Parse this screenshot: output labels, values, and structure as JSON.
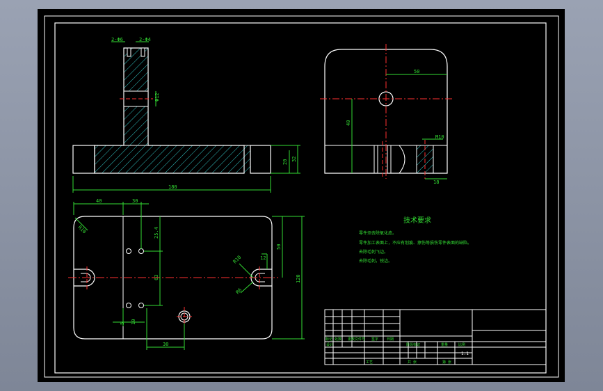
{
  "front_view": {
    "dim_top_left": "2-Φ6",
    "dim_top_right": "2-Φ4",
    "dim_slot": "Φ12",
    "dim_height_inner": "20",
    "dim_height_outer": "32",
    "dim_width": "180"
  },
  "side_view": {
    "dim_horizontal": "50",
    "dim_vertical": "40",
    "dim_small": "M10",
    "dim_bottom": "18"
  },
  "plan_view": {
    "dim_top_a": "40",
    "dim_top_b": "30",
    "dim_vert_a": "25.4",
    "dim_vert_b": "50",
    "dim_center": "63",
    "dim_right_inner": "50",
    "dim_right_outer": "120",
    "dim_right_small": "12",
    "dim_corner_radius": "R10",
    "dim_slot_r": "R10",
    "dim_slot_w": "R6",
    "dim_bottom_a": "5",
    "dim_bottom_b": "10",
    "dim_bottom_c": "30"
  },
  "technical_requirements": {
    "title": "技术要求",
    "lines": [
      "零件须去除氧化皮。",
      "零件加工表面上，不应有划痕、擦伤等损伤零件表面的缺陷。",
      "去除毛刺飞边。",
      "去除毛刺，锐边。"
    ]
  },
  "title_block": {
    "row_labels": [
      "标记",
      "处数",
      "更改文件号",
      "签字",
      "日期"
    ],
    "design": "设计",
    "process": "工艺",
    "stage_label": "阶段标记",
    "weight_label": "重量",
    "scale_label": "比例",
    "scale_value": "1:1",
    "sheet_total": "共 张",
    "sheet_no": "第 张"
  }
}
